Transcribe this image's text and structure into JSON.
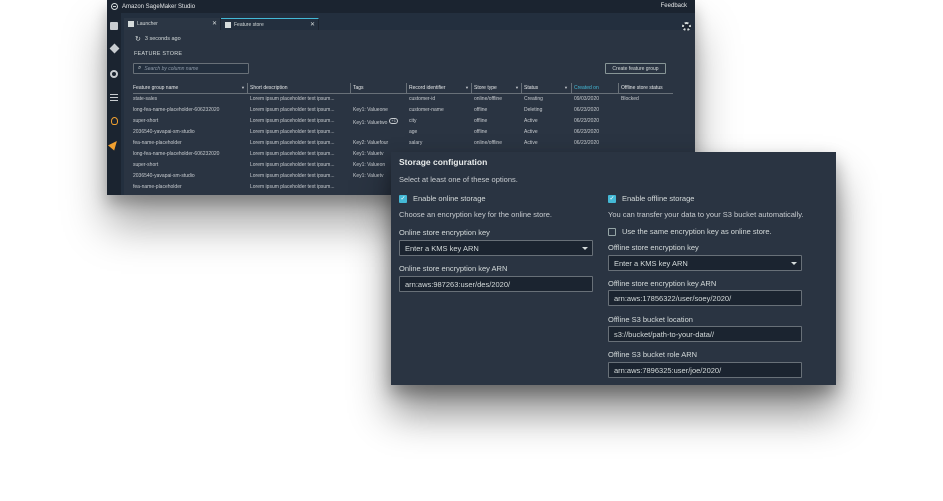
{
  "studio": {
    "app_title": "Amazon SageMaker Studio",
    "feedback_label": "Feedback",
    "sidebar_icons": [
      "folder-icon",
      "git-icon",
      "circle-stop-icon",
      "list-icon",
      "bulb-icon",
      "paper-plane-icon"
    ],
    "tabs": [
      {
        "label": "Launcher",
        "close": "✕"
      },
      {
        "label": "Feature store",
        "close": "✕"
      }
    ],
    "refresh_text": "3 seconds ago",
    "heading": "FEATURE STORE",
    "search_placeholder": "Search by column name",
    "create_button": "Create feature group",
    "table": {
      "columns": [
        "Feature group name",
        "Short description",
        "Tags",
        "Record identifier",
        "Store type",
        "Status",
        "Created on",
        "Offline store status"
      ],
      "rows": [
        [
          "state-sales",
          "Lorem ipsum placeholder text ipsum...",
          "",
          "customer-id",
          "online/offline",
          "Creating",
          "09/03/2020",
          "Blocked"
        ],
        [
          "long-fea-name-placeholder-606232020",
          "Lorem ipsum placeholder text ipsum...",
          "Key1: Valueone",
          "customer-name",
          "offline",
          "Deleting",
          "06/23/2020",
          ""
        ],
        [
          "super-short",
          "Lorem ipsum placeholder text ipsum...",
          "Key1: Valuetwo",
          "city",
          "offline",
          "Active",
          "06/23/2020",
          ""
        ],
        [
          "2036540-yavapai-sm-studio",
          "Lorem ipsum placeholder text ipsum...",
          "",
          "age",
          "offline",
          "Active",
          "06/23/2020",
          ""
        ],
        [
          "fea-name-placeholder",
          "Lorem ipsum placeholder text ipsum...",
          "Key2: Valuefour",
          "salary",
          "online/offline",
          "Active",
          "06/23/2020",
          ""
        ],
        [
          "long-fea-name-placeholder-606232020",
          "Lorem ipsum placeholder text ipsum...",
          "Key1: Valuetv",
          "",
          "",
          "",
          "",
          ""
        ],
        [
          "super-short",
          "Lorem ipsum placeholder text ipsum...",
          "Key1: Valueon",
          "",
          "",
          "",
          "",
          ""
        ],
        [
          "2036540-yavapai-sm-studio",
          "Lorem ipsum placeholder text ipsum...",
          "Key1: Valuetv",
          "",
          "",
          "",
          "",
          ""
        ],
        [
          "fea-name-placeholder",
          "Lorem ipsum placeholder text ipsum...",
          "",
          "",
          "",
          "",
          "",
          ""
        ]
      ],
      "extra_tag_badge": "+1"
    }
  },
  "storage": {
    "title": "Storage configuration",
    "subtitle": "Select at least one of these options.",
    "online": {
      "enable_label": "Enable online storage",
      "enabled": true,
      "help": "Choose an encryption key for the online store.",
      "key_label": "Online store encryption key",
      "key_value": "Enter a KMS key ARN",
      "arn_label": "Online store encryption key ARN",
      "arn_value": "arn:aws:987263:user/des/2020/"
    },
    "offline": {
      "enable_label": "Enable offline storage",
      "enabled": true,
      "help": "You can transfer your data to your S3 bucket automatically.",
      "same_key_label": "Use the same encryption key as online store.",
      "same_key_checked": false,
      "key_label": "Offline store encryption key",
      "key_value": "Enter a KMS key ARN",
      "arn_label": "Offline store encryption key ARN",
      "arn_value": "arn:aws:17856322/user/soey/2020/",
      "bucket_label": "Offline S3 bucket location",
      "bucket_value": "s3://bucket/path-to-your-data//",
      "role_label": "Offline S3 bucket role ARN",
      "role_value": "arn:aws:7896325:user/joe/2020/"
    }
  },
  "colors": {
    "accent": "#44b9d6",
    "panel": "#2a3442",
    "dark": "#1b2430",
    "warning_icon": "#f0a030"
  }
}
